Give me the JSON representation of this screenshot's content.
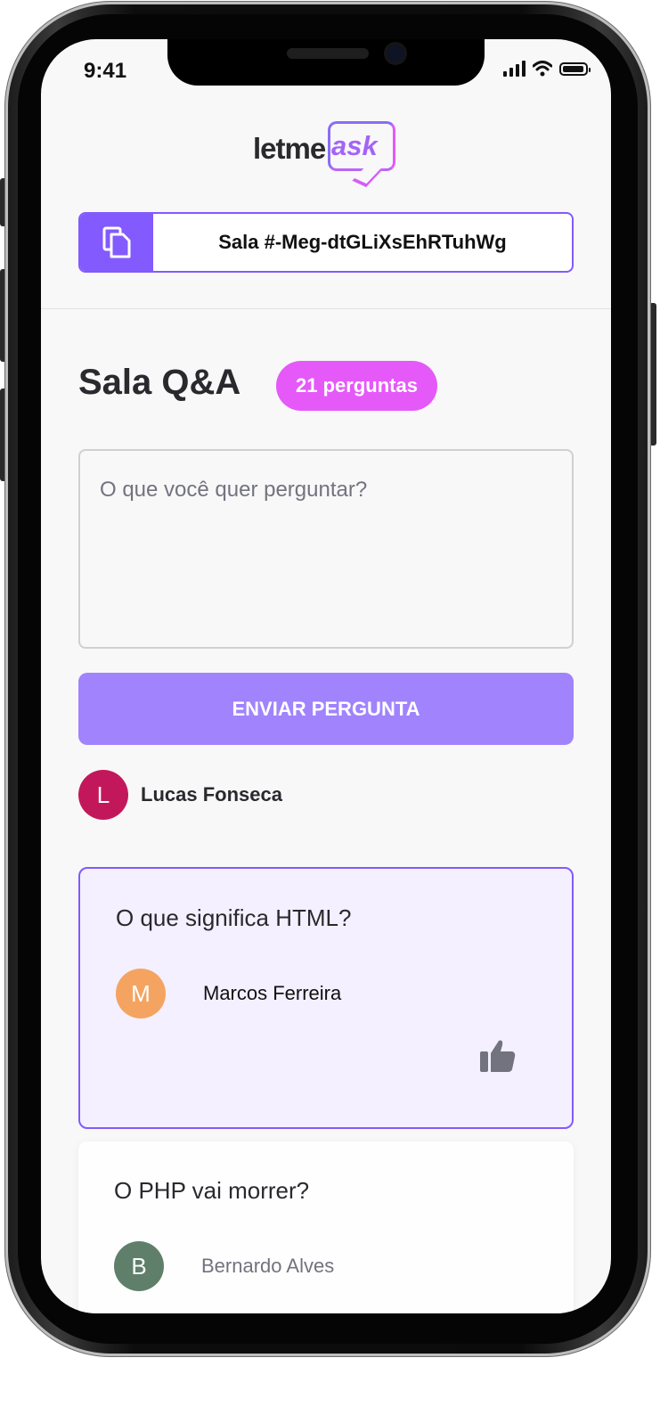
{
  "status_bar": {
    "time": "9:41"
  },
  "logo": {
    "part1": "letme",
    "part2": "ask"
  },
  "room_code": {
    "label": "Sala #-Meg-dtGLiXsEhRTuhWg"
  },
  "room": {
    "title": "Sala Q&A",
    "badge": "21 perguntas"
  },
  "question_form": {
    "placeholder": "O que você quer perguntar?",
    "submit_label": "ENVIAR PERGUNTA"
  },
  "current_user": {
    "initial": "L",
    "name": "Lucas Fonseca",
    "color": "#c2185b"
  },
  "questions": [
    {
      "text": "O que significa HTML?",
      "author": "Marcos Ferreira",
      "initial": "M",
      "avatar_color": "#f4a460",
      "highlighted": true
    },
    {
      "text": "O PHP vai morrer?",
      "author": "Bernardo Alves",
      "initial": "B",
      "avatar_color": "#5f7f6a",
      "highlighted": false
    }
  ],
  "colors": {
    "accent": "#835afd",
    "badge": "#e559f9",
    "button": "#a083fd"
  }
}
